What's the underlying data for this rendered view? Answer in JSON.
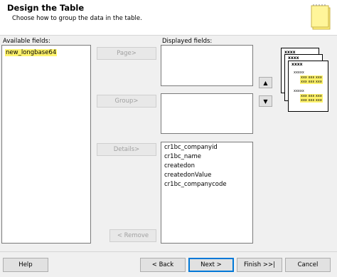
{
  "header": {
    "title": "Design the Table",
    "subtitle": "Choose how to group the data in the table."
  },
  "available": {
    "label": "Available fields:",
    "items": [
      "new_longbase64"
    ]
  },
  "displayed": {
    "label": "Displayed fields:",
    "details_items": [
      "cr1bc_companyid",
      "cr1bc_name",
      "createdon",
      "createdonValue",
      "cr1bc_companycode"
    ]
  },
  "buttons": {
    "page": "Page>",
    "group": "Group>",
    "details": "Details>",
    "remove": "< Remove",
    "move_up": "▲",
    "move_down": "▼"
  },
  "preview": {
    "header_text": "xxxx",
    "detail_text": "xxxxx",
    "row_text": "xxx xxx xxx"
  },
  "footer": {
    "help": "Help",
    "back": "< Back",
    "next": "Next >",
    "finish": "Finish >>|",
    "cancel": "Cancel"
  },
  "colors": {
    "highlight": "#fff36b",
    "header_bg": "#ffffff",
    "dialog_bg": "#f0f0f0"
  }
}
